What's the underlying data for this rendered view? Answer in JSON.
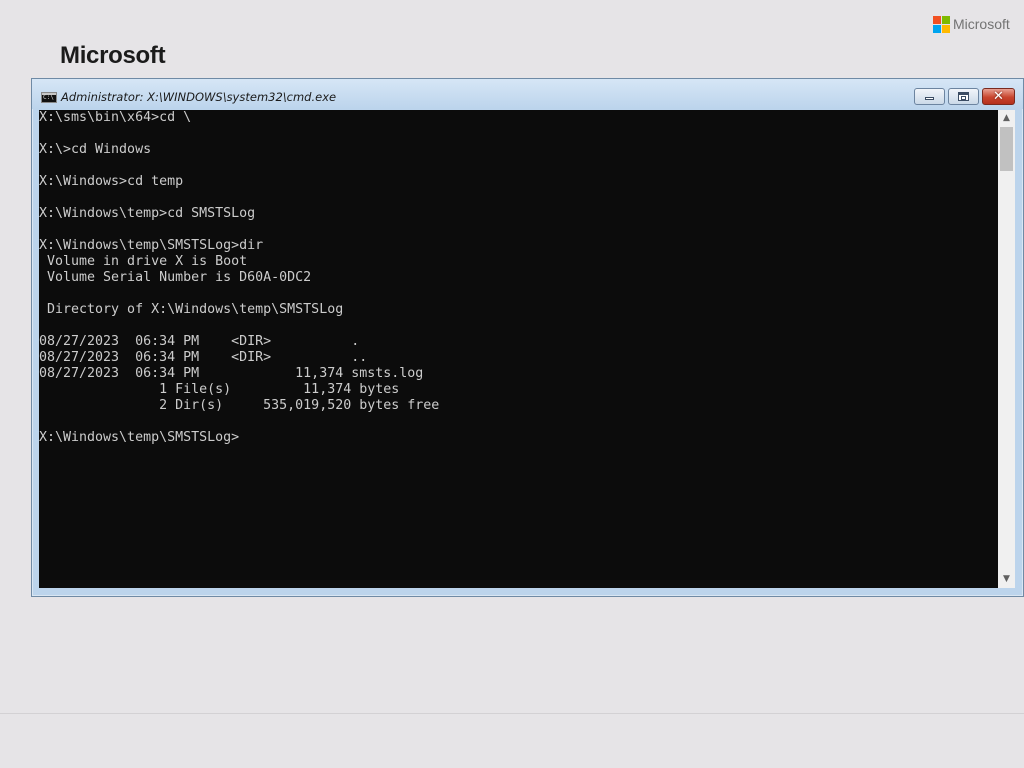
{
  "brand": {
    "title": "Microsoft",
    "logo_text": "Microsoft",
    "logo_colors": [
      "#f25022",
      "#7fba00",
      "#00a4ef",
      "#ffb900"
    ]
  },
  "window": {
    "title": "Administrator: X:\\WINDOWS\\system32\\cmd.exe",
    "icon": "cmd-icon",
    "buttons": {
      "minimize": "minimize-icon",
      "maximize": "maximize-icon",
      "close": "close-icon",
      "close_glyph": "✕"
    }
  },
  "console": {
    "lines": [
      "X:\\sms\\bin\\x64>cd \\",
      "",
      "X:\\>cd Windows",
      "",
      "X:\\Windows>cd temp",
      "",
      "X:\\Windows\\temp>cd SMSTSLog",
      "",
      "X:\\Windows\\temp\\SMSTSLog>dir",
      " Volume in drive X is Boot",
      " Volume Serial Number is D60A-0DC2",
      "",
      " Directory of X:\\Windows\\temp\\SMSTSLog",
      "",
      "08/27/2023  06:34 PM    <DIR>          .",
      "08/27/2023  06:34 PM    <DIR>          ..",
      "08/27/2023  06:34 PM            11,374 smsts.log",
      "               1 File(s)         11,374 bytes",
      "               2 Dir(s)     535,019,520 bytes free",
      "",
      "X:\\Windows\\temp\\SMSTSLog>"
    ],
    "colors": {
      "background": "#0c0c0c",
      "text": "#cccccc"
    }
  },
  "scrollbar": {
    "up_glyph": "▲",
    "down_glyph": "▼"
  }
}
